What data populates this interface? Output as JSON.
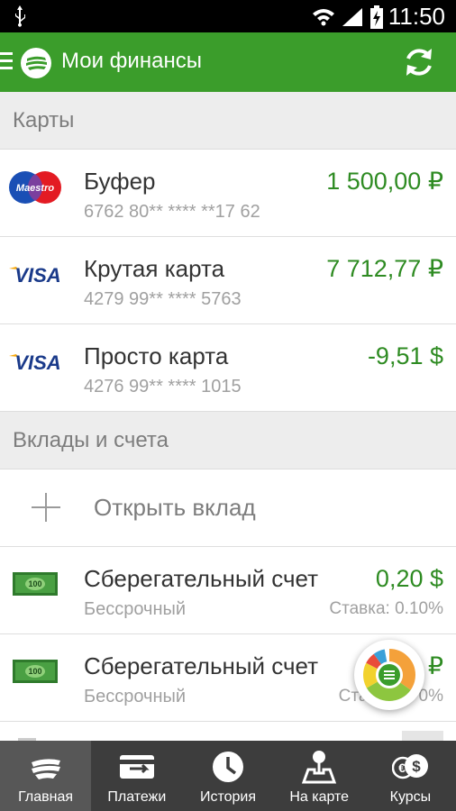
{
  "status_bar": {
    "time": "11:50"
  },
  "app_bar": {
    "title": "Мои финансы"
  },
  "sections": {
    "cards_header": "Карты",
    "deposits_header": "Вклады и счета"
  },
  "cards": [
    {
      "brand": "Maestro",
      "name": "Буфер",
      "number": "6762 80** **** **17 62",
      "amount": "1 500,00 ₽"
    },
    {
      "brand": "VISA",
      "name": "Крутая карта",
      "number": "4279 99** **** 5763",
      "amount": "7 712,77 ₽"
    },
    {
      "brand": "VISA",
      "name": "Просто карта",
      "number": "4276 99** **** 1015",
      "amount": "-9,51 $"
    }
  ],
  "open_deposit": {
    "label": "Открыть вклад"
  },
  "accounts": [
    {
      "name": "Сберегательный счет",
      "term": "Бессрочный",
      "amount": "0,20 $",
      "rate": "Ставка: 0.10%"
    },
    {
      "name": "Сберегательный счет",
      "term": "Бессрочный",
      "amount": "₽",
      "rate": "Став",
      "rate_tail": "0%"
    }
  ],
  "bottom_nav": [
    {
      "label": "Главная",
      "icon": "sberbank-logo-icon"
    },
    {
      "label": "Платежи",
      "icon": "payments-icon"
    },
    {
      "label": "История",
      "icon": "clock-icon"
    },
    {
      "label": "На карте",
      "icon": "map-pin-icon"
    },
    {
      "label": "Курсы",
      "icon": "currency-icon"
    }
  ],
  "colors": {
    "brand_green": "#3b9d2b",
    "amount_green": "#2e8b22",
    "nav_bg": "#3d3d3d"
  }
}
